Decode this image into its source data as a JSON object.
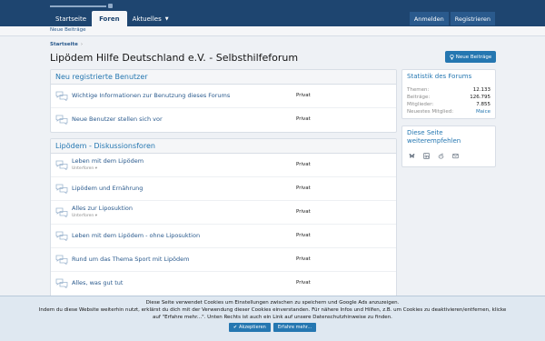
{
  "header": {
    "nav": [
      {
        "label": "Startseite",
        "active": false
      },
      {
        "label": "Foren",
        "active": true
      },
      {
        "label": "Aktuelles",
        "active": false,
        "dropdown": true
      }
    ],
    "login": "Anmelden",
    "register": "Registrieren"
  },
  "subnav": {
    "new_posts": "Neue Beiträge"
  },
  "breadcrumb": {
    "home": "Startseite"
  },
  "page": {
    "title": "Lipödem Hilfe Deutschland e.V. - Selbsthilfeforum",
    "new_posts_button": "Neue Beiträge"
  },
  "categories": [
    {
      "title": "Neu registrierte Benutzer",
      "forums": [
        {
          "title": "Wichtige Informationen zur Benutzung dieses Forums",
          "status": "Privat"
        },
        {
          "title": "Neue Benutzer stellen sich vor",
          "status": "Privat"
        }
      ]
    },
    {
      "title": "Lipödem - Diskussionsforen",
      "forums": [
        {
          "title": "Leben mit dem Lipödem",
          "sub": "Unterforen",
          "status": "Privat"
        },
        {
          "title": "Lipödem und Ernährung",
          "status": "Privat"
        },
        {
          "title": "Alles zur Liposuktion",
          "sub": "Unterforen",
          "status": "Privat"
        },
        {
          "title": "Leben mit dem Lipödem - ohne Liposuktion",
          "status": "Privat"
        },
        {
          "title": "Rund um das Thema Sport mit Lipödem",
          "status": "Privat"
        },
        {
          "title": "Alles, was gut tut",
          "status": "Privat"
        }
      ]
    }
  ],
  "stats": {
    "title": "Statistik des Forums",
    "rows": [
      {
        "label": "Themen:",
        "value": "12.133"
      },
      {
        "label": "Beiträge:",
        "value": "126.795"
      },
      {
        "label": "Mitglieder:",
        "value": "7.855"
      },
      {
        "label": "Neuestes Mitglied:",
        "value": "Maice"
      }
    ]
  },
  "share": {
    "title": "Diese Seite weiterempfehlen",
    "icons": [
      "bluesky-icon",
      "linkedin-icon",
      "reddit-icon",
      "email-icon"
    ]
  },
  "cookie": {
    "line1": "Diese Seite verwendet Cookies um Einstellungen zwischen zu speichern und Google Ads anzuzeigen.",
    "line2": "Indem du diese Website weiterhin nutzt, erklärst du dich mit der Verwendung dieser Cookies einverstanden. Für nähere Infos und Hilfen, z.B. um Cookies zu deaktivieren/entfernen, klicke",
    "line3": "auf \"Erfahre mehr...\". Unten Rechts ist auch ein Link auf unsere Datenschutzhinweise zu finden.",
    "accept": "Akzeptieren",
    "more": "Erfahre mehr..."
  },
  "colors": {
    "header": "#1e4570",
    "accent": "#2577b1",
    "link": "#2a5a8d"
  }
}
